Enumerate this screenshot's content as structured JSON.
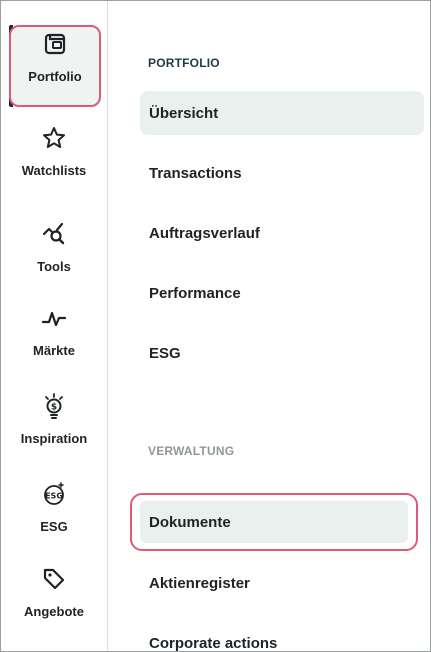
{
  "rail": {
    "items": [
      {
        "label": "Portfolio",
        "icon": "wallet-icon",
        "active": true
      },
      {
        "label": "Watchlists",
        "icon": "star-icon"
      },
      {
        "label": "Tools",
        "icon": "chart-search-icon"
      },
      {
        "label": "Märkte",
        "icon": "pulse-line-icon"
      },
      {
        "label": "Inspiration",
        "icon": "lightbulb-dollar-icon"
      },
      {
        "label": "ESG",
        "icon": "esg-badge-icon"
      },
      {
        "label": "Angebote",
        "icon": "tag-icon"
      }
    ]
  },
  "panel": {
    "portfolio_title": "PORTFOLIO",
    "portfolio_items": [
      {
        "label": "Übersicht",
        "selected": true
      },
      {
        "label": "Transactions"
      },
      {
        "label": "Auftragsverlauf"
      },
      {
        "label": "Performance"
      },
      {
        "label": "ESG"
      }
    ],
    "verwaltung_title": "VERWALTUNG",
    "verwaltung_items": [
      {
        "label": "Dokumente",
        "highlighted": true
      },
      {
        "label": "Aktienregister"
      },
      {
        "label": "Corporate actions"
      }
    ]
  },
  "colors": {
    "highlight_border": "#e05a77",
    "selected_bg": "#eaf0ed",
    "section_primary": "#1d3a4a",
    "section_secondary": "#8f979b"
  }
}
